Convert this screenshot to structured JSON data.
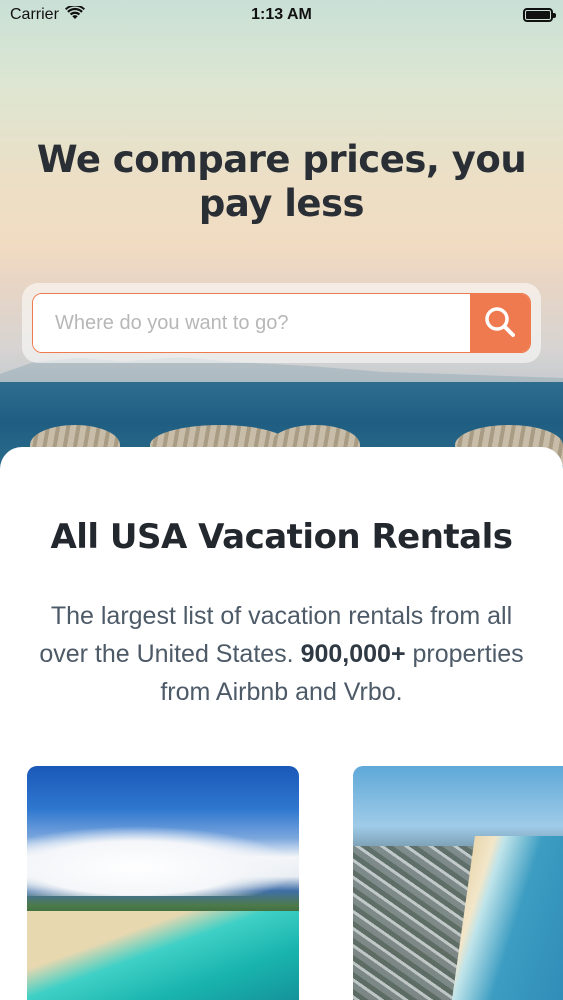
{
  "status_bar": {
    "carrier": "Carrier",
    "time": "1:13 AM"
  },
  "hero": {
    "title": "We compare prices, you pay less"
  },
  "search": {
    "placeholder": "Where do you want to go?"
  },
  "section": {
    "title": "All USA Vacation Rentals",
    "desc_part1": "The largest list of vacation rentals from all over the United States. ",
    "desc_bold": "900,000+",
    "desc_part2": " properties from Airbnb and Vrbo."
  },
  "cards": [
    {
      "image": "hawaii-beach-photo"
    },
    {
      "image": "coastal-town-aerial-photo"
    }
  ],
  "colors": {
    "accent": "#f07a4f",
    "title": "#23282e",
    "body_text": "#4d5a68"
  }
}
